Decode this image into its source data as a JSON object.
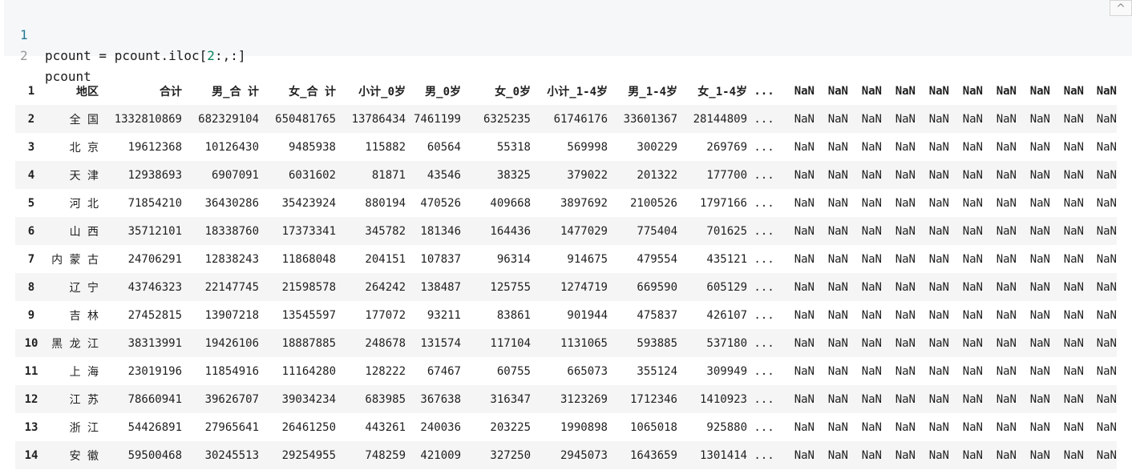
{
  "code_cell": {
    "lines": [
      {
        "number": "1",
        "code_a": "pcount = pcount.iloc[",
        "code_num": "2",
        "code_b": ":,:]"
      },
      {
        "number": "2",
        "code_a": "pcount",
        "code_num": "",
        "code_b": ""
      }
    ],
    "collapse_icon": "chevron-up-icon",
    "collapse_glyph": "^"
  },
  "table": {
    "index_header": "1",
    "columns": [
      "地区",
      "合计",
      "男_合 计",
      "女_合 计",
      "小计_0岁",
      "男_0岁",
      "女_0岁",
      "小计_1-4岁",
      "男_1-4岁",
      "女_1-4岁",
      "...",
      "NaN",
      "NaN",
      "NaN",
      "NaN",
      "NaN",
      "NaN",
      "NaN",
      "NaN",
      "NaN",
      "NaN"
    ],
    "rows": [
      {
        "index": "2",
        "cells": [
          "全 国",
          "1332810869",
          "682329104",
          "650481765",
          "13786434",
          "7461199",
          "6325235",
          "61746176",
          "33601367",
          "28144809",
          "...",
          "NaN",
          "NaN",
          "NaN",
          "NaN",
          "NaN",
          "NaN",
          "NaN",
          "NaN",
          "NaN",
          "NaN"
        ]
      },
      {
        "index": "3",
        "cells": [
          "北 京",
          "19612368",
          "10126430",
          "9485938",
          "115882",
          "60564",
          "55318",
          "569998",
          "300229",
          "269769",
          "...",
          "NaN",
          "NaN",
          "NaN",
          "NaN",
          "NaN",
          "NaN",
          "NaN",
          "NaN",
          "NaN",
          "NaN"
        ]
      },
      {
        "index": "4",
        "cells": [
          "天 津",
          "12938693",
          "6907091",
          "6031602",
          "81871",
          "43546",
          "38325",
          "379022",
          "201322",
          "177700",
          "...",
          "NaN",
          "NaN",
          "NaN",
          "NaN",
          "NaN",
          "NaN",
          "NaN",
          "NaN",
          "NaN",
          "NaN"
        ]
      },
      {
        "index": "5",
        "cells": [
          "河 北",
          "71854210",
          "36430286",
          "35423924",
          "880194",
          "470526",
          "409668",
          "3897692",
          "2100526",
          "1797166",
          "...",
          "NaN",
          "NaN",
          "NaN",
          "NaN",
          "NaN",
          "NaN",
          "NaN",
          "NaN",
          "NaN",
          "NaN"
        ]
      },
      {
        "index": "6",
        "cells": [
          "山 西",
          "35712101",
          "18338760",
          "17373341",
          "345782",
          "181346",
          "164436",
          "1477029",
          "775404",
          "701625",
          "...",
          "NaN",
          "NaN",
          "NaN",
          "NaN",
          "NaN",
          "NaN",
          "NaN",
          "NaN",
          "NaN",
          "NaN"
        ]
      },
      {
        "index": "7",
        "cells": [
          "内 蒙 古",
          "24706291",
          "12838243",
          "11868048",
          "204151",
          "107837",
          "96314",
          "914675",
          "479554",
          "435121",
          "...",
          "NaN",
          "NaN",
          "NaN",
          "NaN",
          "NaN",
          "NaN",
          "NaN",
          "NaN",
          "NaN",
          "NaN"
        ]
      },
      {
        "index": "8",
        "cells": [
          "辽 宁",
          "43746323",
          "22147745",
          "21598578",
          "264242",
          "138487",
          "125755",
          "1274719",
          "669590",
          "605129",
          "...",
          "NaN",
          "NaN",
          "NaN",
          "NaN",
          "NaN",
          "NaN",
          "NaN",
          "NaN",
          "NaN",
          "NaN"
        ]
      },
      {
        "index": "9",
        "cells": [
          "吉 林",
          "27452815",
          "13907218",
          "13545597",
          "177072",
          "93211",
          "83861",
          "901944",
          "475837",
          "426107",
          "...",
          "NaN",
          "NaN",
          "NaN",
          "NaN",
          "NaN",
          "NaN",
          "NaN",
          "NaN",
          "NaN",
          "NaN"
        ]
      },
      {
        "index": "10",
        "cells": [
          "黑 龙 江",
          "38313991",
          "19426106",
          "18887885",
          "248678",
          "131574",
          "117104",
          "1131065",
          "593885",
          "537180",
          "...",
          "NaN",
          "NaN",
          "NaN",
          "NaN",
          "NaN",
          "NaN",
          "NaN",
          "NaN",
          "NaN",
          "NaN"
        ]
      },
      {
        "index": "11",
        "cells": [
          "上 海",
          "23019196",
          "11854916",
          "11164280",
          "128222",
          "67467",
          "60755",
          "665073",
          "355124",
          "309949",
          "...",
          "NaN",
          "NaN",
          "NaN",
          "NaN",
          "NaN",
          "NaN",
          "NaN",
          "NaN",
          "NaN",
          "NaN"
        ]
      },
      {
        "index": "12",
        "cells": [
          "江 苏",
          "78660941",
          "39626707",
          "39034234",
          "683985",
          "367638",
          "316347",
          "3123269",
          "1712346",
          "1410923",
          "...",
          "NaN",
          "NaN",
          "NaN",
          "NaN",
          "NaN",
          "NaN",
          "NaN",
          "NaN",
          "NaN",
          "NaN"
        ]
      },
      {
        "index": "13",
        "cells": [
          "浙 江",
          "54426891",
          "27965641",
          "26461250",
          "443261",
          "240036",
          "203225",
          "1990898",
          "1065018",
          "925880",
          "...",
          "NaN",
          "NaN",
          "NaN",
          "NaN",
          "NaN",
          "NaN",
          "NaN",
          "NaN",
          "NaN",
          "NaN"
        ]
      },
      {
        "index": "14",
        "cells": [
          "安 徽",
          "59500468",
          "30245513",
          "29254955",
          "748259",
          "421009",
          "327250",
          "2945073",
          "1643659",
          "1301414",
          "...",
          "NaN",
          "NaN",
          "NaN",
          "NaN",
          "NaN",
          "NaN",
          "NaN",
          "NaN",
          "NaN",
          "NaN"
        ]
      }
    ]
  },
  "colors": {
    "code_background": "#f5f7f9",
    "line_number_active": "#237893",
    "number_literal": "#098658",
    "stripe": "#f5f5f5"
  }
}
